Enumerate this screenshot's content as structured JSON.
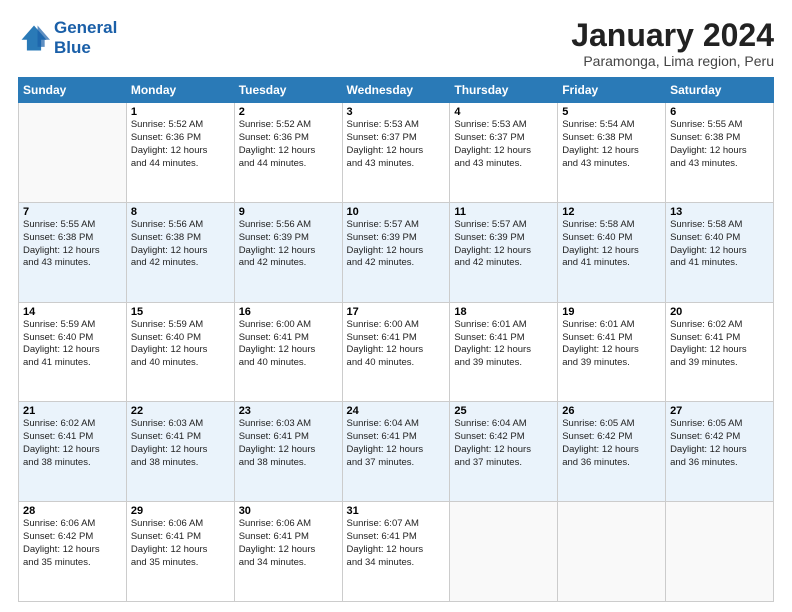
{
  "header": {
    "logo_line1": "General",
    "logo_line2": "Blue",
    "title": "January 2024",
    "subtitle": "Paramonga, Lima region, Peru"
  },
  "weekdays": [
    "Sunday",
    "Monday",
    "Tuesday",
    "Wednesday",
    "Thursday",
    "Friday",
    "Saturday"
  ],
  "weeks": [
    [
      {
        "day": "",
        "sunrise": "",
        "sunset": "",
        "daylight": ""
      },
      {
        "day": "1",
        "sunrise": "Sunrise: 5:52 AM",
        "sunset": "Sunset: 6:36 PM",
        "daylight": "Daylight: 12 hours and 44 minutes."
      },
      {
        "day": "2",
        "sunrise": "Sunrise: 5:52 AM",
        "sunset": "Sunset: 6:36 PM",
        "daylight": "Daylight: 12 hours and 44 minutes."
      },
      {
        "day": "3",
        "sunrise": "Sunrise: 5:53 AM",
        "sunset": "Sunset: 6:37 PM",
        "daylight": "Daylight: 12 hours and 43 minutes."
      },
      {
        "day": "4",
        "sunrise": "Sunrise: 5:53 AM",
        "sunset": "Sunset: 6:37 PM",
        "daylight": "Daylight: 12 hours and 43 minutes."
      },
      {
        "day": "5",
        "sunrise": "Sunrise: 5:54 AM",
        "sunset": "Sunset: 6:38 PM",
        "daylight": "Daylight: 12 hours and 43 minutes."
      },
      {
        "day": "6",
        "sunrise": "Sunrise: 5:55 AM",
        "sunset": "Sunset: 6:38 PM",
        "daylight": "Daylight: 12 hours and 43 minutes."
      }
    ],
    [
      {
        "day": "7",
        "sunrise": "Sunrise: 5:55 AM",
        "sunset": "Sunset: 6:38 PM",
        "daylight": "Daylight: 12 hours and 43 minutes."
      },
      {
        "day": "8",
        "sunrise": "Sunrise: 5:56 AM",
        "sunset": "Sunset: 6:38 PM",
        "daylight": "Daylight: 12 hours and 42 minutes."
      },
      {
        "day": "9",
        "sunrise": "Sunrise: 5:56 AM",
        "sunset": "Sunset: 6:39 PM",
        "daylight": "Daylight: 12 hours and 42 minutes."
      },
      {
        "day": "10",
        "sunrise": "Sunrise: 5:57 AM",
        "sunset": "Sunset: 6:39 PM",
        "daylight": "Daylight: 12 hours and 42 minutes."
      },
      {
        "day": "11",
        "sunrise": "Sunrise: 5:57 AM",
        "sunset": "Sunset: 6:39 PM",
        "daylight": "Daylight: 12 hours and 42 minutes."
      },
      {
        "day": "12",
        "sunrise": "Sunrise: 5:58 AM",
        "sunset": "Sunset: 6:40 PM",
        "daylight": "Daylight: 12 hours and 41 minutes."
      },
      {
        "day": "13",
        "sunrise": "Sunrise: 5:58 AM",
        "sunset": "Sunset: 6:40 PM",
        "daylight": "Daylight: 12 hours and 41 minutes."
      }
    ],
    [
      {
        "day": "14",
        "sunrise": "Sunrise: 5:59 AM",
        "sunset": "Sunset: 6:40 PM",
        "daylight": "Daylight: 12 hours and 41 minutes."
      },
      {
        "day": "15",
        "sunrise": "Sunrise: 5:59 AM",
        "sunset": "Sunset: 6:40 PM",
        "daylight": "Daylight: 12 hours and 40 minutes."
      },
      {
        "day": "16",
        "sunrise": "Sunrise: 6:00 AM",
        "sunset": "Sunset: 6:41 PM",
        "daylight": "Daylight: 12 hours and 40 minutes."
      },
      {
        "day": "17",
        "sunrise": "Sunrise: 6:00 AM",
        "sunset": "Sunset: 6:41 PM",
        "daylight": "Daylight: 12 hours and 40 minutes."
      },
      {
        "day": "18",
        "sunrise": "Sunrise: 6:01 AM",
        "sunset": "Sunset: 6:41 PM",
        "daylight": "Daylight: 12 hours and 39 minutes."
      },
      {
        "day": "19",
        "sunrise": "Sunrise: 6:01 AM",
        "sunset": "Sunset: 6:41 PM",
        "daylight": "Daylight: 12 hours and 39 minutes."
      },
      {
        "day": "20",
        "sunrise": "Sunrise: 6:02 AM",
        "sunset": "Sunset: 6:41 PM",
        "daylight": "Daylight: 12 hours and 39 minutes."
      }
    ],
    [
      {
        "day": "21",
        "sunrise": "Sunrise: 6:02 AM",
        "sunset": "Sunset: 6:41 PM",
        "daylight": "Daylight: 12 hours and 38 minutes."
      },
      {
        "day": "22",
        "sunrise": "Sunrise: 6:03 AM",
        "sunset": "Sunset: 6:41 PM",
        "daylight": "Daylight: 12 hours and 38 minutes."
      },
      {
        "day": "23",
        "sunrise": "Sunrise: 6:03 AM",
        "sunset": "Sunset: 6:41 PM",
        "daylight": "Daylight: 12 hours and 38 minutes."
      },
      {
        "day": "24",
        "sunrise": "Sunrise: 6:04 AM",
        "sunset": "Sunset: 6:41 PM",
        "daylight": "Daylight: 12 hours and 37 minutes."
      },
      {
        "day": "25",
        "sunrise": "Sunrise: 6:04 AM",
        "sunset": "Sunset: 6:42 PM",
        "daylight": "Daylight: 12 hours and 37 minutes."
      },
      {
        "day": "26",
        "sunrise": "Sunrise: 6:05 AM",
        "sunset": "Sunset: 6:42 PM",
        "daylight": "Daylight: 12 hours and 36 minutes."
      },
      {
        "day": "27",
        "sunrise": "Sunrise: 6:05 AM",
        "sunset": "Sunset: 6:42 PM",
        "daylight": "Daylight: 12 hours and 36 minutes."
      }
    ],
    [
      {
        "day": "28",
        "sunrise": "Sunrise: 6:06 AM",
        "sunset": "Sunset: 6:42 PM",
        "daylight": "Daylight: 12 hours and 35 minutes."
      },
      {
        "day": "29",
        "sunrise": "Sunrise: 6:06 AM",
        "sunset": "Sunset: 6:41 PM",
        "daylight": "Daylight: 12 hours and 35 minutes."
      },
      {
        "day": "30",
        "sunrise": "Sunrise: 6:06 AM",
        "sunset": "Sunset: 6:41 PM",
        "daylight": "Daylight: 12 hours and 34 minutes."
      },
      {
        "day": "31",
        "sunrise": "Sunrise: 6:07 AM",
        "sunset": "Sunset: 6:41 PM",
        "daylight": "Daylight: 12 hours and 34 minutes."
      },
      {
        "day": "",
        "sunrise": "",
        "sunset": "",
        "daylight": ""
      },
      {
        "day": "",
        "sunrise": "",
        "sunset": "",
        "daylight": ""
      },
      {
        "day": "",
        "sunrise": "",
        "sunset": "",
        "daylight": ""
      }
    ]
  ]
}
